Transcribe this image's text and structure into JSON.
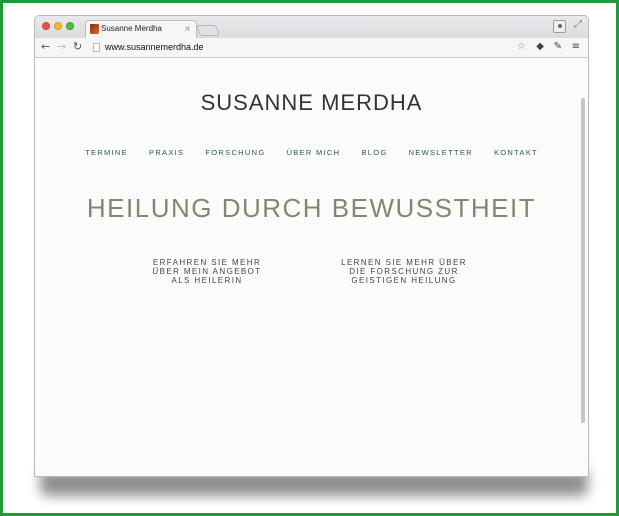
{
  "browser": {
    "tab_title": "Susanne Merdha",
    "tab_close": "×",
    "url": "www.susannemerdha.de",
    "icons": {
      "back": "arrow-left",
      "forward": "arrow-right",
      "reload": "reload",
      "bookmark": "star",
      "menu": "hamburger"
    }
  },
  "site": {
    "title": "SUSANNE MERDHA",
    "nav": [
      "TERMINE",
      "PRAXIS",
      "FORSCHUNG",
      "ÜBER MICH",
      "BLOG",
      "NEWSLETTER",
      "KONTAKT"
    ],
    "headline": "HEILUNG DURCH BEWUSSTHEIT",
    "teaser_left": [
      "ERFAHREN SIE MEHR",
      "ÜBER MEIN ANGEBOT",
      "ALS HEILERIN"
    ],
    "teaser_right": [
      "LERNEN SIE MEHR ÜBER",
      "DIE FORSCHUNG ZUR",
      "GEISTIGEN HEILUNG"
    ]
  },
  "colors": {
    "frame": "#1f9a3a",
    "nav_text": "#2b5a46",
    "headline": "#8a846e",
    "title": "#333333"
  }
}
